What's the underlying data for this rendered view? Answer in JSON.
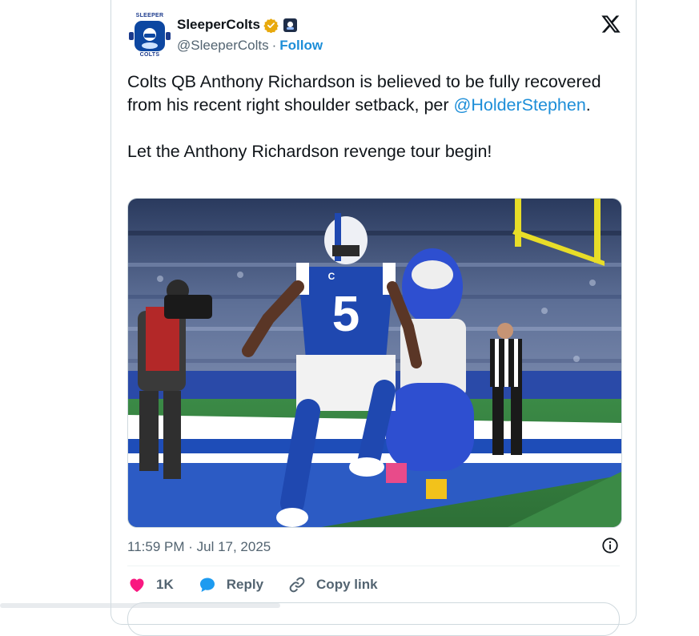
{
  "account": {
    "display_name": "SleeperColts",
    "handle": "@SleeperColts",
    "separator": "·",
    "follow_label": "Follow",
    "avatar_top_text": "SLEEPER",
    "avatar_bottom_text": "COLTS",
    "verified_color": "#e8a90d",
    "brand_color": "#0d47a1"
  },
  "tweet": {
    "line1": "Colts QB Anthony Richardson is believed to be fully recovered from his recent right shoulder setback, per",
    "mention": "@HolderStephen",
    "mention_suffix": ".",
    "line2": "Let the Anthony Richardson revenge tour begin!",
    "timestamp": "11:59 PM · Jul 17, 2025"
  },
  "photo": {
    "jersey_number": "5",
    "captain_patch": "C"
  },
  "actions": {
    "like_count": "1K",
    "reply_label": "Reply",
    "copy_link_label": "Copy link",
    "like_color": "#f91880",
    "reply_color": "#1d9bf0"
  },
  "icons": [
    "verified-badge-icon",
    "x-logo-icon",
    "info-icon",
    "heart-icon",
    "reply-bubble-icon",
    "link-icon"
  ]
}
